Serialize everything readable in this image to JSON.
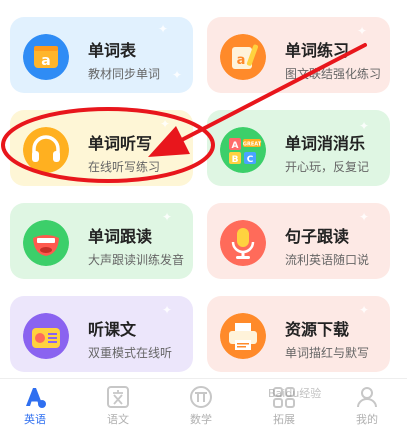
{
  "cards": [
    {
      "title": "单词表",
      "subtitle": "教材同步单词",
      "icon": "letter-a-book-icon",
      "color": "#e1f1fe"
    },
    {
      "title": "单词练习",
      "subtitle": "图文联结强化练习",
      "icon": "pencil-a-icon",
      "color": "#fde9e5"
    },
    {
      "title": "单词听写",
      "subtitle": "在线听写练习",
      "icon": "headphones-icon",
      "color": "#fef6d6"
    },
    {
      "title": "单词消消乐",
      "subtitle": "开心玩，反复记",
      "icon": "abc-blocks-icon",
      "color": "#dff6e3"
    },
    {
      "title": "单词跟读",
      "subtitle": "大声跟读训练发音",
      "icon": "singing-mouth-icon",
      "color": "#dff6e3"
    },
    {
      "title": "句子跟读",
      "subtitle": "流利英语随口说",
      "icon": "microphone-icon",
      "color": "#fde9e5"
    },
    {
      "title": "听课文",
      "subtitle": "双重模式在线听",
      "icon": "radio-icon",
      "color": "#ece6fb"
    },
    {
      "title": "资源下载",
      "subtitle": "单词描红与默写",
      "icon": "printer-icon",
      "color": "#fde9e5"
    }
  ],
  "icon_texts": {
    "block_a": "A",
    "block_b": "B",
    "block_c": "C",
    "great": "GREAT"
  },
  "tabs": [
    {
      "label": "英语",
      "icon": "english-a-icon",
      "active": true
    },
    {
      "label": "语文",
      "icon": "chinese-wen-icon",
      "active": false
    },
    {
      "label": "数学",
      "icon": "math-pi-icon",
      "active": false
    },
    {
      "label": "拓展",
      "icon": "expand-icon",
      "active": false
    },
    {
      "label": "我的",
      "icon": "profile-icon",
      "active": false
    }
  ],
  "watermark": "Baidu经验",
  "colors": {
    "accent": "#2f6ff0",
    "annotation_red": "#e8161c"
  }
}
